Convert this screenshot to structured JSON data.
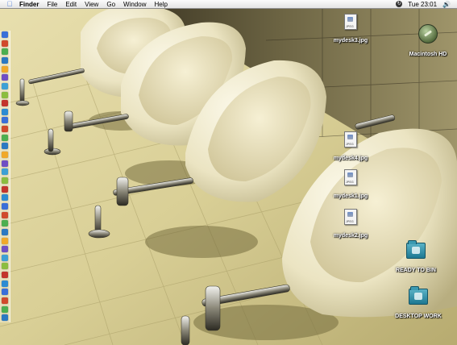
{
  "menubar": {
    "apple_icon": "apple-icon",
    "app_name": "Finder",
    "menus": [
      "File",
      "Edit",
      "View",
      "Go",
      "Window",
      "Help"
    ],
    "status_icon": "sync-status-icon",
    "clock": "Tue 23:01",
    "volume_icon": "speaker-icon"
  },
  "desktop": {
    "wallpaper": "photo of row of ceramic urinals on tiled wall",
    "icons": [
      {
        "label": "mydesk3.jpg",
        "type": "jpeg-file-icon"
      },
      {
        "label": "Macintosh HD",
        "type": "hard-drive-icon"
      },
      {
        "label": "mydesk4.jpg",
        "type": "jpeg-file-icon"
      },
      {
        "label": "mydesk1.jpg",
        "type": "jpeg-file-icon"
      },
      {
        "label": "mydesk2.jpg",
        "type": "jpeg-file-icon"
      },
      {
        "label": "READY TO BIN",
        "type": "folder-icon"
      },
      {
        "label": "DESKTOP WORK",
        "type": "folder-icon"
      }
    ]
  },
  "dock": {
    "position": "left",
    "item_count": 34,
    "colors": [
      "#3a6fd8",
      "#d04a2c",
      "#4caf50",
      "#2b79c2",
      "#f0a92a",
      "#6f4fc4",
      "#3da0d5",
      "#8bbd3f",
      "#c3342d",
      "#2d8bd2"
    ]
  }
}
